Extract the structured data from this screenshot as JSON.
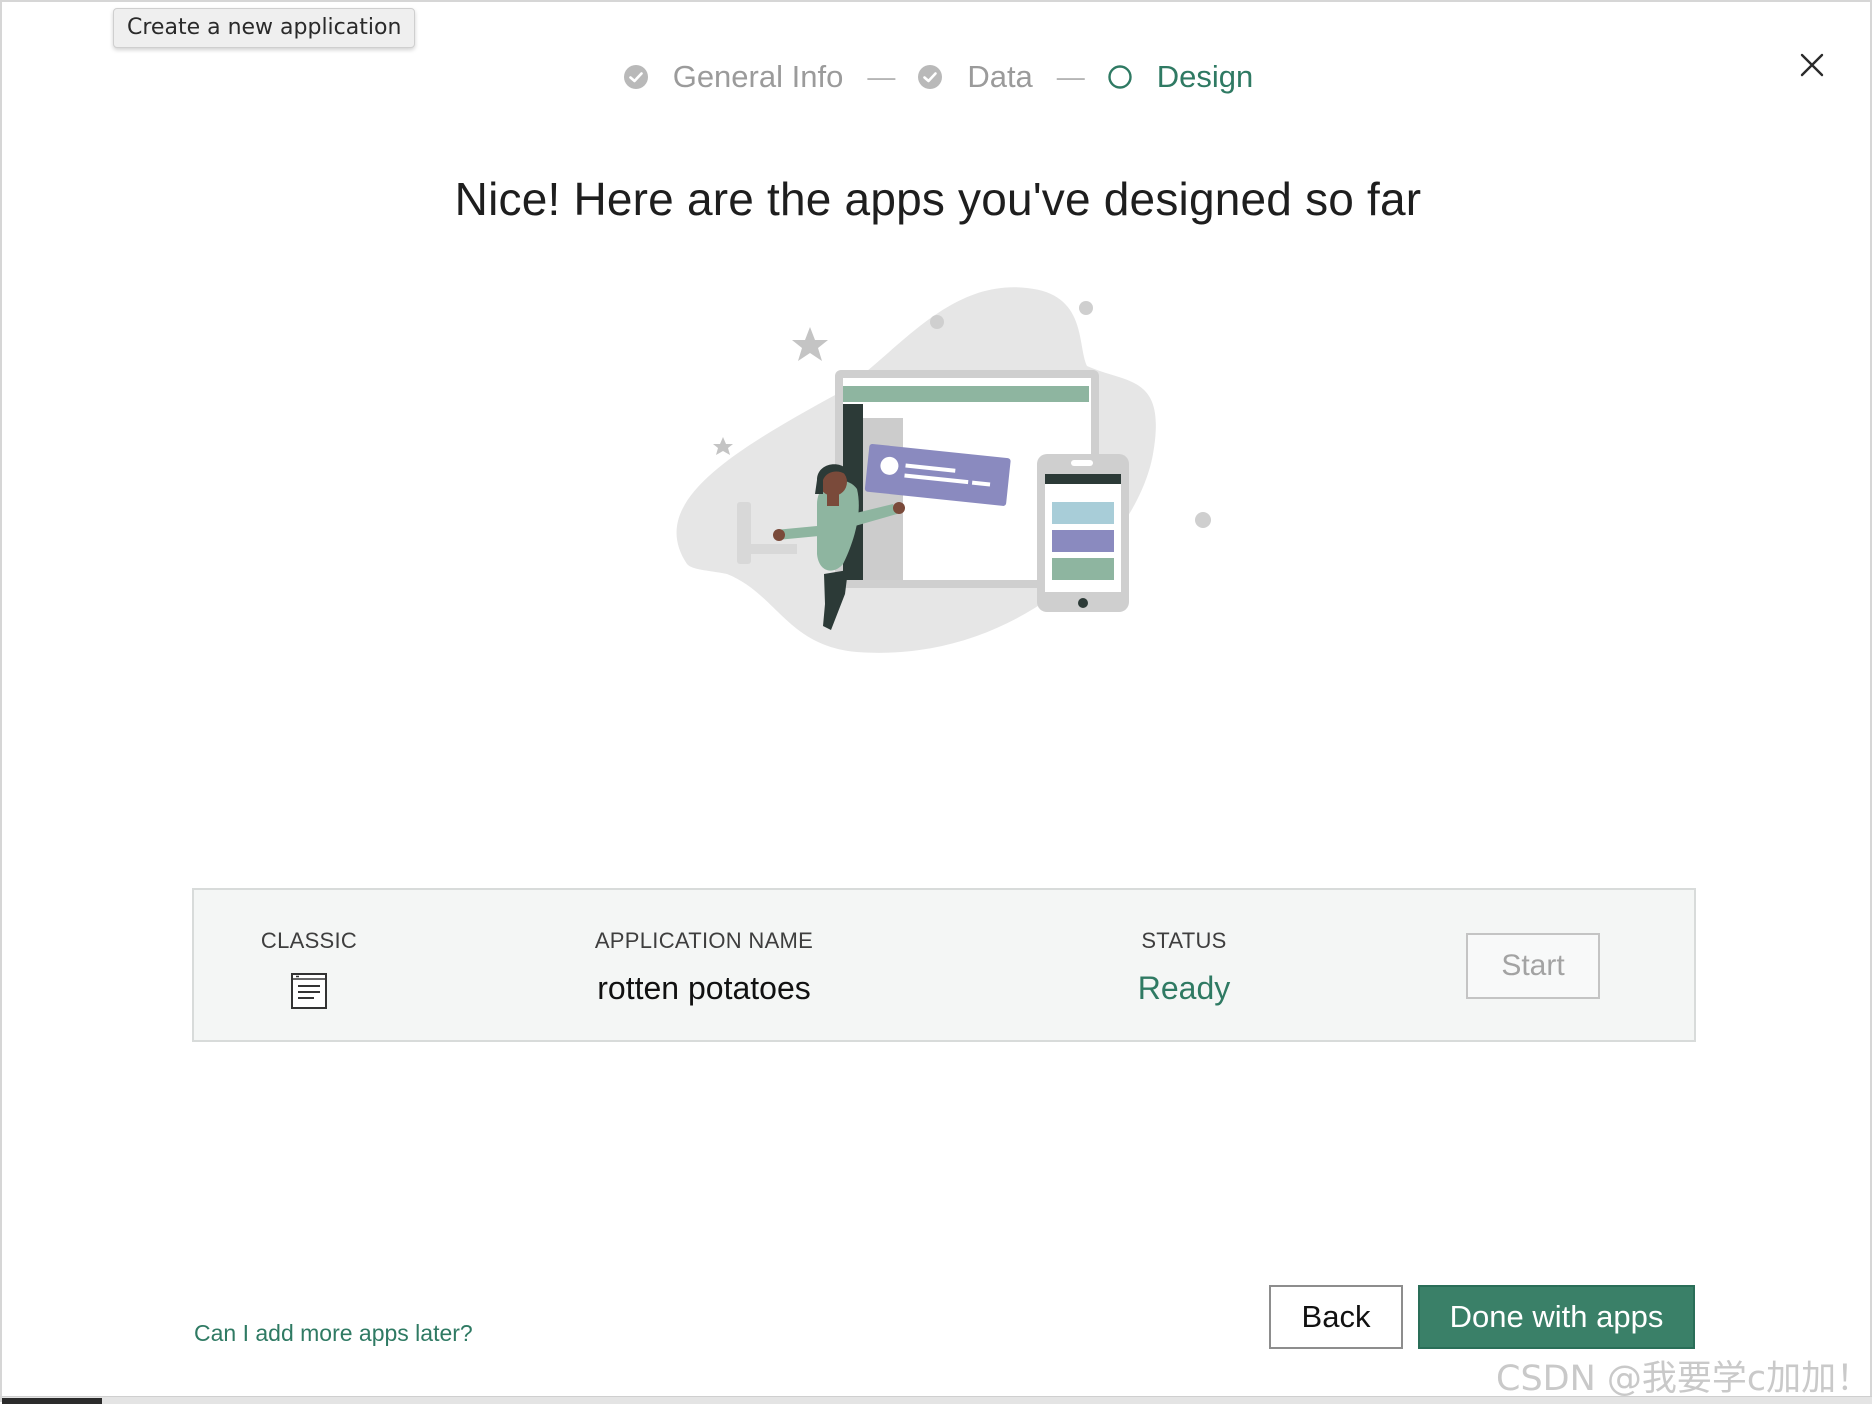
{
  "tooltip": "Create a new application",
  "stepper": {
    "steps": [
      {
        "label": "General Info",
        "state": "done"
      },
      {
        "label": "Data",
        "state": "done"
      },
      {
        "label": "Design",
        "state": "active"
      }
    ],
    "separator": "—"
  },
  "heading": "Nice! Here are the apps you've designed so far",
  "app_table": {
    "columns": {
      "classic": "CLASSIC",
      "name": "APPLICATION NAME",
      "status": "STATUS"
    },
    "rows": [
      {
        "classic_icon": "form-icon",
        "name": "rotten potatoes",
        "status": "Ready",
        "action": "Start"
      }
    ]
  },
  "footer": {
    "help_link": "Can I add more apps later?",
    "back_label": "Back",
    "done_label": "Done with apps"
  },
  "watermark": "CSDN @我要学c加加！",
  "colors": {
    "accent": "#3a8068",
    "accent_text": "#2f7a63",
    "muted": "#9b9b9b",
    "card_bg": "#f4f6f5"
  },
  "icons": [
    "check-circle-icon",
    "empty-circle-icon",
    "close-icon",
    "form-icon"
  ]
}
